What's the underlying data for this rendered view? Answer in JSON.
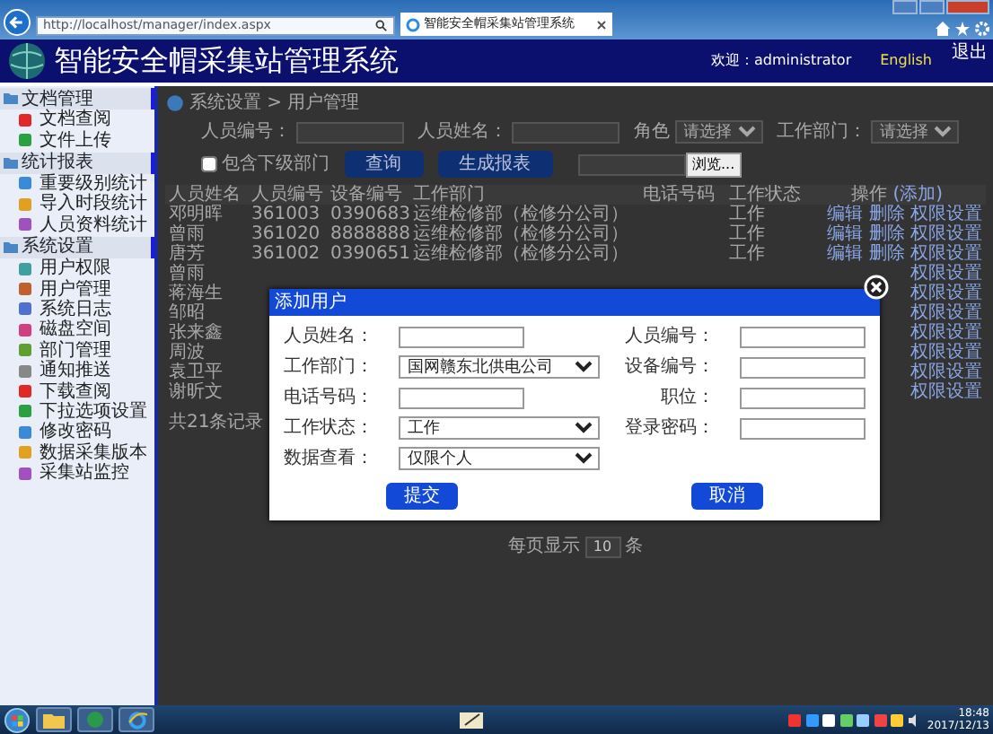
{
  "browser": {
    "address": "http://localhost/manager/index.aspx",
    "tab_title": "智能安全帽采集站管理系统"
  },
  "header": {
    "title": "智能安全帽采集站管理系统",
    "welcome": "欢迎：administrator",
    "language": "English",
    "logout": "退出"
  },
  "sidebar": [
    {
      "label": "文档管理",
      "children": [
        {
          "label": "文档查阅"
        },
        {
          "label": "文件上传"
        }
      ]
    },
    {
      "label": "统计报表",
      "children": [
        {
          "label": "重要级别统计"
        },
        {
          "label": "导入时段统计"
        },
        {
          "label": "人员资料统计"
        }
      ]
    },
    {
      "label": "系统设置",
      "children": [
        {
          "label": "用户权限"
        },
        {
          "label": "用户管理"
        },
        {
          "label": "系统日志"
        },
        {
          "label": "磁盘空间"
        },
        {
          "label": "部门管理"
        },
        {
          "label": "通知推送"
        },
        {
          "label": "下载查阅"
        },
        {
          "label": "下拉选项设置"
        },
        {
          "label": "修改密码"
        },
        {
          "label": "数据采集版本"
        },
        {
          "label": "采集站监控"
        }
      ]
    }
  ],
  "breadcrumb": "系统设置 > 用户管理",
  "filters": {
    "fields": [
      {
        "kind": "input",
        "label": "人员编号："
      },
      {
        "kind": "input",
        "label": "人员姓名："
      },
      {
        "kind": "select",
        "label": "角色",
        "value": "请选择"
      },
      {
        "kind": "select",
        "label": "工作部门：",
        "value": "请选择"
      },
      {
        "kind": "checkbox",
        "label": "包含下级部门",
        "checked": false
      }
    ],
    "buttons": [
      "查询",
      "生成报表"
    ],
    "browse": "浏览..."
  },
  "table": {
    "columns": [
      "人员姓名",
      "人员编号",
      "设备编号",
      "工作部门",
      "电话号码",
      "工作状态",
      "操作"
    ],
    "add_link": "(添加)",
    "rows": [
      {
        "name": "邓明晖",
        "id": "361003",
        "device": "0390683",
        "dept": "运维检修部（检修分公司）",
        "status": "工作",
        "actions": [
          "编辑",
          "删除",
          "权限设置"
        ]
      },
      {
        "name": "曾雨",
        "id": "361020",
        "device": "8888888",
        "dept": "运维检修部（检修分公司）",
        "status": "工作",
        "actions": [
          "编辑",
          "删除",
          "权限设置"
        ]
      },
      {
        "name": "唐芳",
        "id": "361002",
        "device": "0390651",
        "dept": "运维检修部（检修分公司）",
        "status": "工作",
        "actions": [
          "编辑",
          "删除",
          "权限设置"
        ]
      },
      {
        "name": "曾雨",
        "actions": [
          "权限设置"
        ]
      },
      {
        "name": "蒋海生",
        "actions": [
          "权限设置"
        ]
      },
      {
        "name": "邹昭",
        "actions": [
          "权限设置"
        ]
      },
      {
        "name": "张来鑫",
        "actions": [
          "权限设置"
        ]
      },
      {
        "name": "周波",
        "actions": [
          "权限设置"
        ]
      },
      {
        "name": "袁卫平",
        "actions": [
          "权限设置"
        ]
      },
      {
        "name": "谢昕文",
        "actions": [
          "权限设置"
        ]
      }
    ]
  },
  "total": "共21条记录",
  "pager": {
    "prefix": "每页显示",
    "value": "10",
    "suffix": "条"
  },
  "dialog": {
    "title": "添加用户",
    "fields": [
      {
        "kind": "input",
        "label": "人员姓名："
      },
      {
        "kind": "input",
        "label": "人员编号："
      },
      {
        "kind": "select",
        "label": "工作部门：",
        "value": "国网赣东北供电公司"
      },
      {
        "kind": "input",
        "label": "设备编号："
      },
      {
        "kind": "input",
        "label": "电话号码："
      },
      {
        "kind": "input",
        "label": "职位："
      },
      {
        "kind": "select",
        "label": "工作状态：",
        "value": "工作"
      },
      {
        "kind": "input",
        "label": "登录密码："
      },
      {
        "kind": "select",
        "label": "数据查看：",
        "value": "仅限个人"
      }
    ],
    "buttons": [
      "提交",
      "取消"
    ]
  },
  "taskbar": {
    "time": "18:48",
    "date": "2017/12/13"
  }
}
